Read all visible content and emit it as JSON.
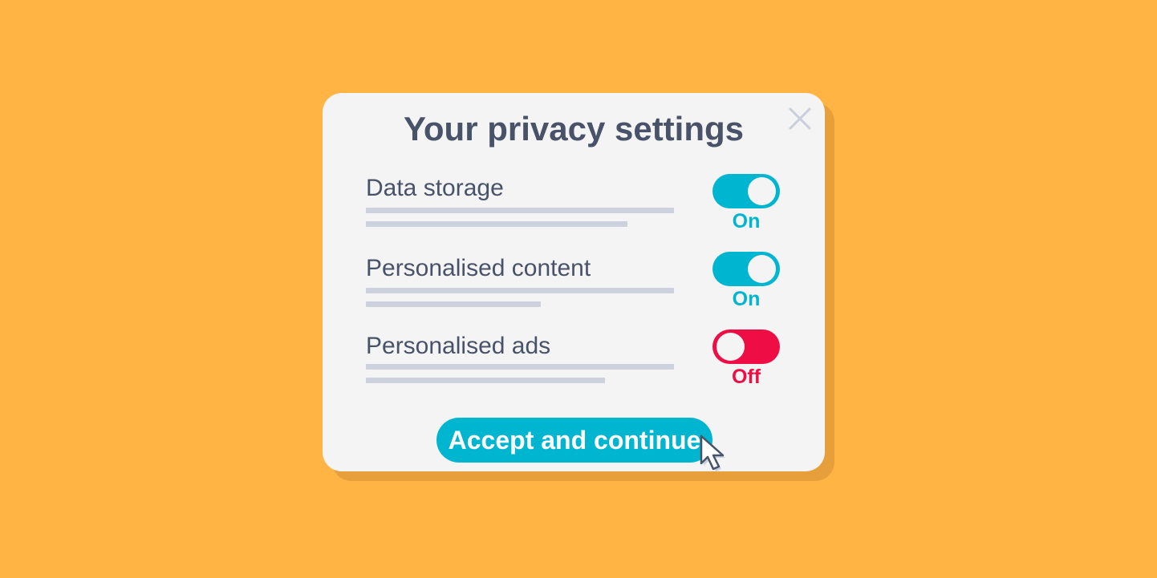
{
  "dialog": {
    "title": "Your privacy settings",
    "close_icon": "close-icon",
    "settings": [
      {
        "label": "Data storage",
        "state_label": "On",
        "enabled": true
      },
      {
        "label": "Personalised content",
        "state_label": "On",
        "enabled": true
      },
      {
        "label": "Personalised ads",
        "state_label": "Off",
        "enabled": false
      }
    ],
    "accept_label": "Accept and continue"
  },
  "colors": {
    "background": "#FFB444",
    "dialog": "#F4F4F4",
    "text": "#485369",
    "accent_on": "#00B5D0",
    "accent_off": "#EE0D45",
    "placeholder_line": "#CDD1DE"
  },
  "icons": {
    "close": "close-icon",
    "pointer": "mouse-pointer-icon"
  }
}
